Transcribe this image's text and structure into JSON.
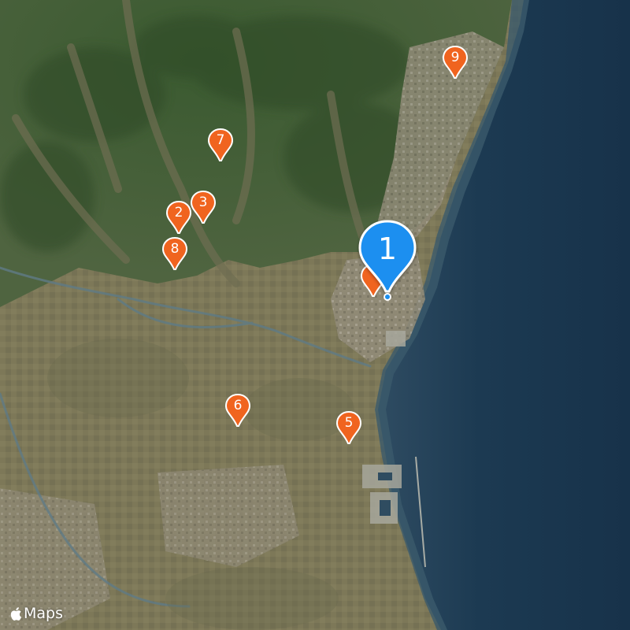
{
  "map": {
    "attribution": "Maps",
    "colors": {
      "ocean": "#1a3348",
      "coast_water": "#3d5a6e",
      "forest": "#3f5a32",
      "farmland": "#7a7656",
      "urban": "#8d8875",
      "pin": "#f0641f",
      "selected_pin": "#1a8ff0",
      "location_dot": "#1a8ff0"
    },
    "pins": [
      {
        "label": "2",
        "icon": "map-pin-icon"
      },
      {
        "label": "3",
        "icon": "map-pin-icon"
      },
      {
        "label": "5",
        "icon": "map-pin-icon"
      },
      {
        "label": "6",
        "icon": "map-pin-icon"
      },
      {
        "label": "7",
        "icon": "map-pin-icon"
      },
      {
        "label": "8",
        "icon": "map-pin-icon"
      },
      {
        "label": "9",
        "icon": "map-pin-icon"
      }
    ],
    "selected_pin": {
      "label": "1",
      "icon": "selected-map-pin-icon"
    }
  }
}
